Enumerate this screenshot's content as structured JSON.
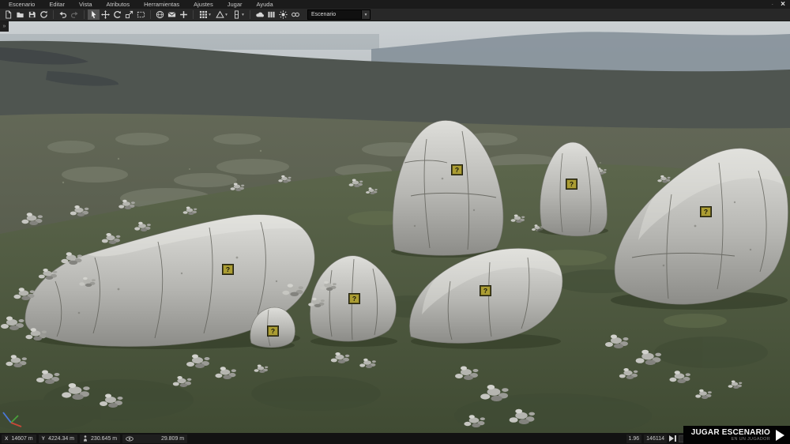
{
  "menubar": {
    "items": [
      "Escenario",
      "Editar",
      "Vista",
      "Atributos",
      "Herramientas",
      "Ajustes",
      "Jugar",
      "Ayuda"
    ]
  },
  "window_controls": {
    "minimize": "·",
    "close": "×"
  },
  "toolbar": {
    "scenario_dropdown": "Escenario",
    "caret": "▾"
  },
  "viewport": {
    "panel_toggle": "»",
    "markers": [
      "?",
      "?",
      "?",
      "?",
      "?",
      "?",
      "?"
    ]
  },
  "statusbar": {
    "camera_x_label": "X",
    "camera_x": "14607 m",
    "camera_y_label": "Y",
    "camera_y": "4224.34 m",
    "camera_height": "230.645 m",
    "view_distance": "29.809 m",
    "sim_speed": "1.96",
    "object_count": "146114"
  },
  "play_button": {
    "title": "JUGAR ESCENARIO",
    "subtitle": "EN UN JUGADOR"
  },
  "colors": {
    "marker_fill": "#ab9d33",
    "marker_border": "#21210f",
    "toolbar_bg": "#282828",
    "menubar_bg": "#1b1b1b",
    "statusbar_bg": "#121212",
    "play_button_bg": "#030303",
    "sky": "#c9ced1",
    "far_ridge": "#4f5550",
    "grass": "#55604a",
    "rock_light": "#d8d8d4"
  }
}
